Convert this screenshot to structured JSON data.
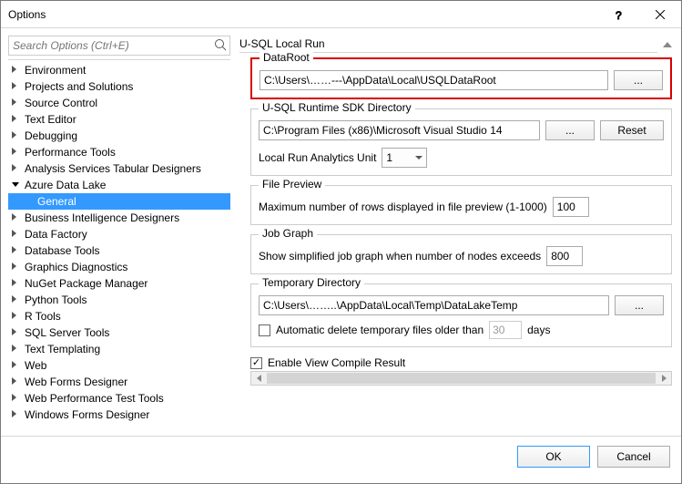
{
  "window": {
    "title": "Options"
  },
  "search": {
    "placeholder": "Search Options (Ctrl+E)"
  },
  "tree": {
    "items": [
      {
        "label": "Environment",
        "expanded": false,
        "level": 1
      },
      {
        "label": "Projects and Solutions",
        "expanded": false,
        "level": 1
      },
      {
        "label": "Source Control",
        "expanded": false,
        "level": 1
      },
      {
        "label": "Text Editor",
        "expanded": false,
        "level": 1
      },
      {
        "label": "Debugging",
        "expanded": false,
        "level": 1
      },
      {
        "label": "Performance Tools",
        "expanded": false,
        "level": 1
      },
      {
        "label": "Analysis Services Tabular Designers",
        "expanded": false,
        "level": 1
      },
      {
        "label": "Azure Data Lake",
        "expanded": true,
        "level": 1
      },
      {
        "label": "General",
        "level": 2,
        "selected": true
      },
      {
        "label": "Business Intelligence Designers",
        "expanded": false,
        "level": 1
      },
      {
        "label": "Data Factory",
        "expanded": false,
        "level": 1
      },
      {
        "label": "Database Tools",
        "expanded": false,
        "level": 1
      },
      {
        "label": "Graphics Diagnostics",
        "expanded": false,
        "level": 1
      },
      {
        "label": "NuGet Package Manager",
        "expanded": false,
        "level": 1
      },
      {
        "label": "Python Tools",
        "expanded": false,
        "level": 1
      },
      {
        "label": "R Tools",
        "expanded": false,
        "level": 1
      },
      {
        "label": "SQL Server Tools",
        "expanded": false,
        "level": 1
      },
      {
        "label": "Text Templating",
        "expanded": false,
        "level": 1
      },
      {
        "label": "Web",
        "expanded": false,
        "level": 1
      },
      {
        "label": "Web Forms Designer",
        "expanded": false,
        "level": 1
      },
      {
        "label": "Web Performance Test Tools",
        "expanded": false,
        "level": 1
      },
      {
        "label": "Windows Forms Designer",
        "expanded": false,
        "level": 1
      }
    ]
  },
  "main": {
    "section_title": "U-SQL Local Run",
    "dataroot": {
      "legend": "DataRoot",
      "value": "C:\\Users\\……---\\AppData\\Local\\USQLDataRoot",
      "browse": "..."
    },
    "runtime": {
      "legend": "U-SQL Runtime SDK Directory",
      "value": "C:\\Program Files (x86)\\Microsoft Visual Studio 14",
      "browse": "...",
      "reset": "Reset",
      "analytics_label": "Local Run Analytics Unit",
      "analytics_value": "1"
    },
    "preview": {
      "legend": "File Preview",
      "label": "Maximum number of rows displayed in file preview (1-1000)",
      "value": "100"
    },
    "jobgraph": {
      "legend": "Job Graph",
      "label": "Show simplified job graph when number of nodes exceeds",
      "value": "800"
    },
    "tempdir": {
      "legend": "Temporary Directory",
      "value": "C:\\Users\\……..\\AppData\\Local\\Temp\\DataLakeTemp",
      "browse": "...",
      "autodelete_label_pre": "Automatic delete temporary files older than",
      "autodelete_days": "30",
      "autodelete_label_post": "days",
      "autodelete_checked": false
    },
    "enable_compile": {
      "label": "Enable View Compile Result",
      "checked": true
    }
  },
  "footer": {
    "ok": "OK",
    "cancel": "Cancel"
  }
}
